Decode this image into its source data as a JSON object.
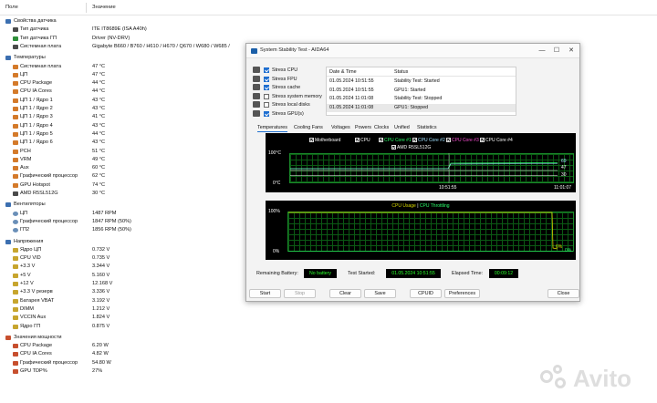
{
  "columns": {
    "field": "Поле",
    "value": "Значение"
  },
  "tree": [
    {
      "type": "group",
      "label": "Свойства датчика",
      "icon": "sensor-props-icon"
    },
    {
      "type": "item",
      "label": "Тип датчика",
      "value": "ITE IT8689E  (ISA A40h)",
      "icon": "chip-icon"
    },
    {
      "type": "item",
      "label": "Тип датчика ГП",
      "value": "Driver  (NV-DRV)",
      "icon": "gpu-icon"
    },
    {
      "type": "item",
      "label": "Системная плата",
      "value": "Gigabyte B660 / B760 / H610 / H670 / Q670 / W680 / W685 /",
      "icon": "motherboard-icon"
    },
    {
      "type": "group",
      "label": "Температуры",
      "icon": "temperature-icon"
    },
    {
      "type": "item",
      "label": "Системная плата",
      "value": "47 °C",
      "icon": "temp-icon"
    },
    {
      "type": "item",
      "label": "ЦП",
      "value": "47 °C",
      "icon": "temp-icon"
    },
    {
      "type": "item",
      "label": "CPU Package",
      "value": "44 °C",
      "icon": "temp-icon"
    },
    {
      "type": "item",
      "label": "CPU IA Cores",
      "value": "44 °C",
      "icon": "temp-icon"
    },
    {
      "type": "item",
      "label": "ЦП 1 / Ядро 1",
      "value": "43 °C",
      "icon": "temp-icon"
    },
    {
      "type": "item",
      "label": "ЦП 1 / Ядро 2",
      "value": "43 °C",
      "icon": "temp-icon"
    },
    {
      "type": "item",
      "label": "ЦП 1 / Ядро 3",
      "value": "41 °C",
      "icon": "temp-icon"
    },
    {
      "type": "item",
      "label": "ЦП 1 / Ядро 4",
      "value": "43 °C",
      "icon": "temp-icon"
    },
    {
      "type": "item",
      "label": "ЦП 1 / Ядро 5",
      "value": "44 °C",
      "icon": "temp-icon"
    },
    {
      "type": "item",
      "label": "ЦП 1 / Ядро 6",
      "value": "43 °C",
      "icon": "temp-icon"
    },
    {
      "type": "item",
      "label": "PCH",
      "value": "51 °C",
      "icon": "temp-icon"
    },
    {
      "type": "item",
      "label": "VRM",
      "value": "49 °C",
      "icon": "temp-icon"
    },
    {
      "type": "item",
      "label": "Aux",
      "value": "60 °C",
      "icon": "temp-icon"
    },
    {
      "type": "item",
      "label": "Графический процессор",
      "value": "62 °C",
      "icon": "temp-icon"
    },
    {
      "type": "item",
      "label": "GPU Hotspot",
      "value": "74 °C",
      "icon": "temp-icon"
    },
    {
      "type": "item",
      "label": "AMD R5SL512G",
      "value": "30 °C",
      "icon": "drive-icon"
    },
    {
      "type": "group",
      "label": "Вентиляторы",
      "icon": "fans-icon"
    },
    {
      "type": "item",
      "label": "ЦП",
      "value": "1487 RPM",
      "icon": "fan-icon"
    },
    {
      "type": "item",
      "label": "Графический процессор",
      "value": "1847 RPM  (50%)",
      "icon": "fan-icon"
    },
    {
      "type": "item",
      "label": "ГП2",
      "value": "1856 RPM  (50%)",
      "icon": "fan-icon"
    },
    {
      "type": "group",
      "label": "Напряжения",
      "icon": "voltages-icon"
    },
    {
      "type": "item",
      "label": "Ядро ЦП",
      "value": "0.732 V",
      "icon": "volt-icon"
    },
    {
      "type": "item",
      "label": "CPU VID",
      "value": "0.735 V",
      "icon": "volt-icon"
    },
    {
      "type": "item",
      "label": "+3.3 V",
      "value": "3.344 V",
      "icon": "volt-icon"
    },
    {
      "type": "item",
      "label": "+5 V",
      "value": "5.160 V",
      "icon": "volt-icon"
    },
    {
      "type": "item",
      "label": "+12 V",
      "value": "12.168 V",
      "icon": "volt-icon"
    },
    {
      "type": "item",
      "label": "+3.3 V резерв",
      "value": "3.336 V",
      "icon": "volt-icon"
    },
    {
      "type": "item",
      "label": "Батарея VBAT",
      "value": "3.192 V",
      "icon": "volt-icon"
    },
    {
      "type": "item",
      "label": "DIMM",
      "value": "1.212 V",
      "icon": "volt-icon"
    },
    {
      "type": "item",
      "label": "VCCIN Aux",
      "value": "1.824 V",
      "icon": "volt-icon"
    },
    {
      "type": "item",
      "label": "Ядро ГП",
      "value": "0.875 V",
      "icon": "volt-icon"
    },
    {
      "type": "group",
      "label": "Значения мощности",
      "icon": "power-icon"
    },
    {
      "type": "item",
      "label": "CPU Package",
      "value": "6.20 W",
      "icon": "power-icon"
    },
    {
      "type": "item",
      "label": "CPU IA Cores",
      "value": "4.82 W",
      "icon": "power-icon"
    },
    {
      "type": "item",
      "label": "Графический процессор",
      "value": "54.80 W",
      "icon": "power-icon"
    },
    {
      "type": "item",
      "label": "GPU TDP%",
      "value": "27%",
      "icon": "power-icon"
    }
  ],
  "window": {
    "title": "System Stability Test - AIDA64",
    "controls": {
      "minimize": "—",
      "maximize": "☐",
      "close": "✕"
    },
    "stress_options": [
      {
        "label": "Stress CPU",
        "checked": true,
        "icon": "cpu-icon"
      },
      {
        "label": "Stress FPU",
        "checked": true,
        "icon": "fpu-icon"
      },
      {
        "label": "Stress cache",
        "checked": true,
        "icon": "cache-icon"
      },
      {
        "label": "Stress system memory",
        "checked": false,
        "icon": "memory-icon"
      },
      {
        "label": "Stress local disks",
        "checked": false,
        "icon": "disk-icon"
      },
      {
        "label": "Stress GPU(s)",
        "checked": true,
        "icon": "gpu-icon"
      }
    ],
    "log": {
      "headers": {
        "date": "Date & Time",
        "status": "Status"
      },
      "rows": [
        {
          "date": "01.05.2024 10:51:55",
          "status": "Stability Test: Started"
        },
        {
          "date": "01.05.2024 10:51:55",
          "status": "GPU1: Started"
        },
        {
          "date": "01.05.2024 11:01:08",
          "status": "Stability Test: Stopped"
        },
        {
          "date": "01.05.2024 11:01:08",
          "status": "GPU1: Stopped"
        }
      ]
    },
    "tabs": [
      "Temperatures",
      "Cooling Fans",
      "Voltages",
      "Powers",
      "Clocks",
      "Unified",
      "Statistics"
    ],
    "active_tab": "Temperatures",
    "temp_graph": {
      "legend": [
        {
          "label": "Motherboard",
          "color": "#ffffff"
        },
        {
          "label": "CPU",
          "color": "#ffffff"
        },
        {
          "label": "CPU Core #1",
          "color": "#2aff6a"
        },
        {
          "label": "CPU Core #2",
          "color": "#9fe0ff"
        },
        {
          "label": "CPU Core #3",
          "color": "#ff4fd8"
        },
        {
          "label": "CPU Core #4",
          "color": "#ffffff"
        },
        {
          "label": "AMD R5SL512G",
          "color": "#ffffff"
        }
      ],
      "y_top": "100°C",
      "y_bottom": "0°C",
      "x_start": "10:51:55",
      "x_end": "11:01:07",
      "right_values": [
        "69",
        "47",
        "30"
      ]
    },
    "usage_graph": {
      "title_usage": "CPU Usage",
      "title_sep": "|",
      "title_throttle": "CPU Throttling",
      "y_top": "100%",
      "y_bottom": "0%",
      "right_values": [
        "6%",
        "0%"
      ]
    },
    "status": {
      "battery_label": "Remaining Battery:",
      "battery_value": "No battery",
      "started_label": "Test Started:",
      "started_value": "01.05.2024 10:51:55",
      "elapsed_label": "Elapsed Time:",
      "elapsed_value": "00:09:12"
    },
    "buttons": {
      "start": "Start",
      "stop": "Stop",
      "clear": "Clear",
      "save": "Save",
      "cpuid": "CPUID",
      "preferences": "Preferences",
      "close": "Close"
    }
  },
  "chart_data": [
    {
      "type": "line",
      "title": "",
      "ylabel": "",
      "ylim": [
        0,
        100
      ],
      "x": [
        "10:51:55",
        "11:01:07"
      ],
      "series": [
        {
          "name": "CPU Core #1",
          "values": [
            44,
            69
          ]
        },
        {
          "name": "Motherboard",
          "values": [
            47,
            47
          ]
        },
        {
          "name": "AMD R5SL512G",
          "values": [
            30,
            30
          ]
        }
      ]
    },
    {
      "type": "line",
      "title": "CPU Usage | CPU Throttling",
      "ylim": [
        0,
        100
      ],
      "series": [
        {
          "name": "CPU Usage",
          "values": [
            100,
            6
          ]
        },
        {
          "name": "CPU Throttling",
          "values": [
            0,
            0
          ]
        }
      ]
    }
  ],
  "watermark": "Avito"
}
